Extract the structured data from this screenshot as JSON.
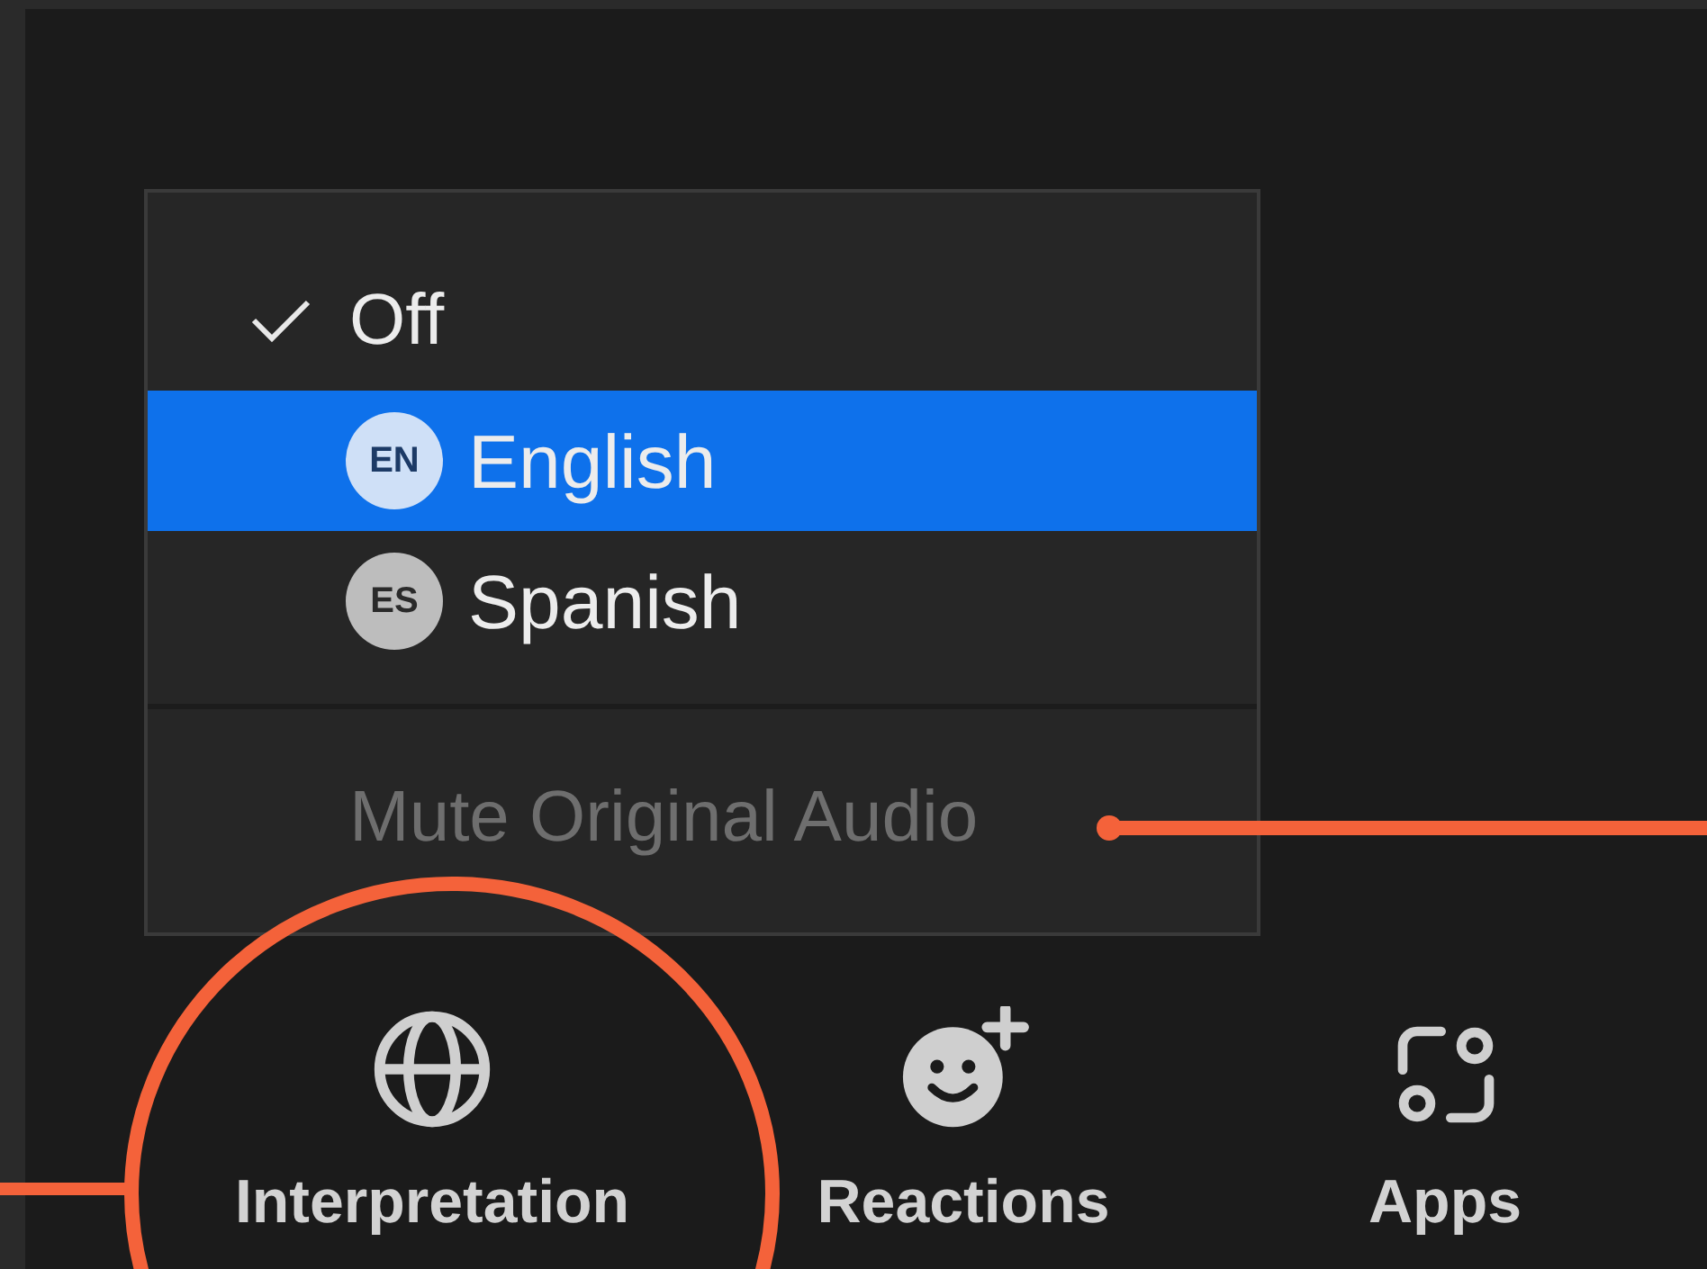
{
  "menu": {
    "items": [
      {
        "kind": "check",
        "label": "Off",
        "checked": true,
        "selected": false
      },
      {
        "kind": "language",
        "badge": "EN",
        "label": "English",
        "selected": true
      },
      {
        "kind": "language",
        "badge": "ES",
        "label": "Spanish",
        "selected": false
      },
      {
        "kind": "action",
        "label": "Mute Original Audio",
        "disabled": true
      }
    ]
  },
  "toolbar": [
    {
      "kind": "globe",
      "label": "Interpretation"
    },
    {
      "kind": "reactions",
      "label": "Reactions"
    },
    {
      "kind": "apps",
      "label": "Apps"
    }
  ]
}
